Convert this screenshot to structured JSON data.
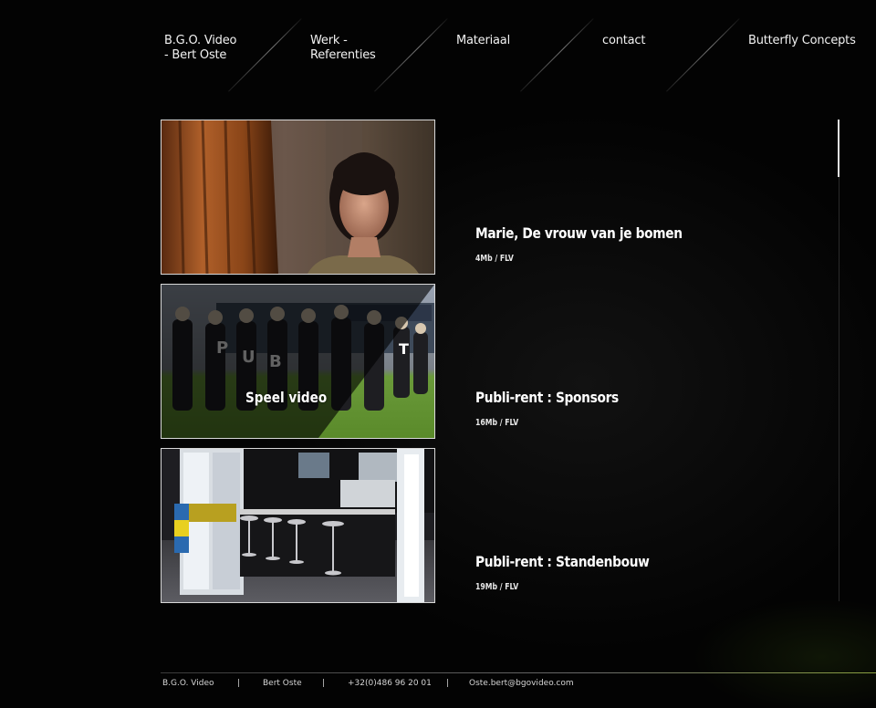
{
  "nav": {
    "items": [
      {
        "label": "B.G.O. Video\n- Bert Oste"
      },
      {
        "label": "Werk -\nReferenties"
      },
      {
        "label": "Materiaal"
      },
      {
        "label": "contact"
      },
      {
        "label": "Butterfly Concepts"
      }
    ]
  },
  "videos": [
    {
      "title": "Marie, De vrouw van je bomen",
      "meta": "4Mb / FLV"
    },
    {
      "title": "Publi-rent : Sponsors",
      "meta": "16Mb / FLV",
      "overlay_label": "Speel video"
    },
    {
      "title": "Publi-rent : Standenbouw",
      "meta": "19Mb / FLV"
    }
  ],
  "footer": {
    "company": "B.G.O. Video",
    "name": "Bert Oste",
    "phone": "+32(0)486 96 20 01",
    "email": "Oste.bert@bgovideo.com",
    "separator": "|"
  },
  "colors": {
    "background": "#030303",
    "text": "#ffffff",
    "thumb_border": "#d8d8d8",
    "footer_accent": "#8aa040"
  }
}
